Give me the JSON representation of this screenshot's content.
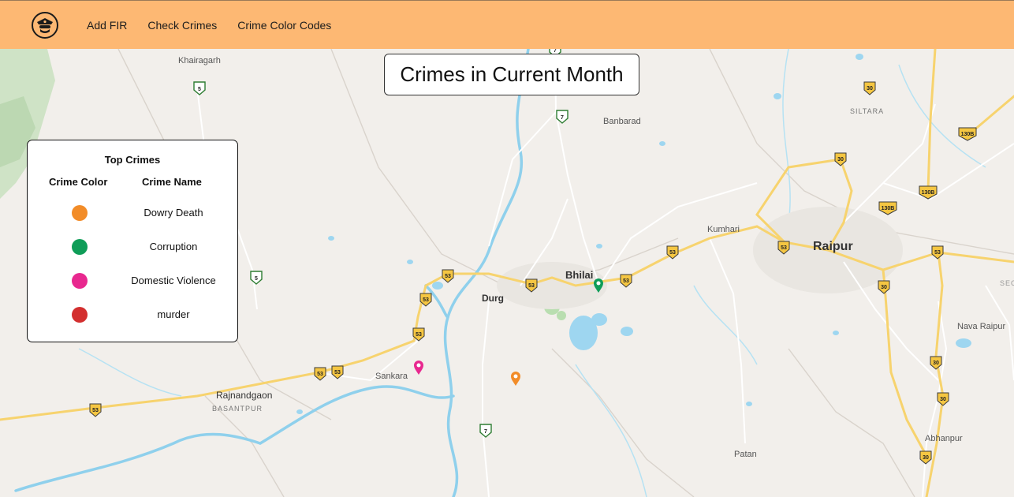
{
  "navbar": {
    "logo_icon": "police-officer-icon",
    "links": [
      "Add FIR",
      "Check Crimes",
      "Crime Color Codes"
    ]
  },
  "map": {
    "title": "Crimes in Current Month",
    "places": {
      "khairagarh": "Khairagarh",
      "banbarad": "Banbarad",
      "siltara": "SILTARA",
      "kumhari": "Kumhari",
      "raipur": "Raipur",
      "bhilai": "Bhilai",
      "durg": "Durg",
      "nava_raipur": "Nava Raipur",
      "sankara": "Sankara",
      "rajnandgaon": "Rajnandgaon",
      "basantpur": "BASANTPUR",
      "abhanpur": "Abhanpur",
      "patan": "Patan",
      "sec": "SEC"
    },
    "markers": [
      {
        "crime": "Corruption",
        "color": "#0f9d58"
      },
      {
        "crime": "Domestic Violence",
        "color": "#e8288f"
      },
      {
        "crime": "Dowry Death",
        "color": "#f28c28"
      }
    ]
  },
  "legend": {
    "title": "Top Crimes",
    "col_color": "Crime Color",
    "col_name": "Crime Name",
    "rows": [
      {
        "name": "Dowry Death",
        "color": "#f28c28"
      },
      {
        "name": "Corruption",
        "color": "#0f9d58"
      },
      {
        "name": "Domestic Violence",
        "color": "#e8288f"
      },
      {
        "name": "murder",
        "color": "#d32f2f"
      }
    ]
  }
}
